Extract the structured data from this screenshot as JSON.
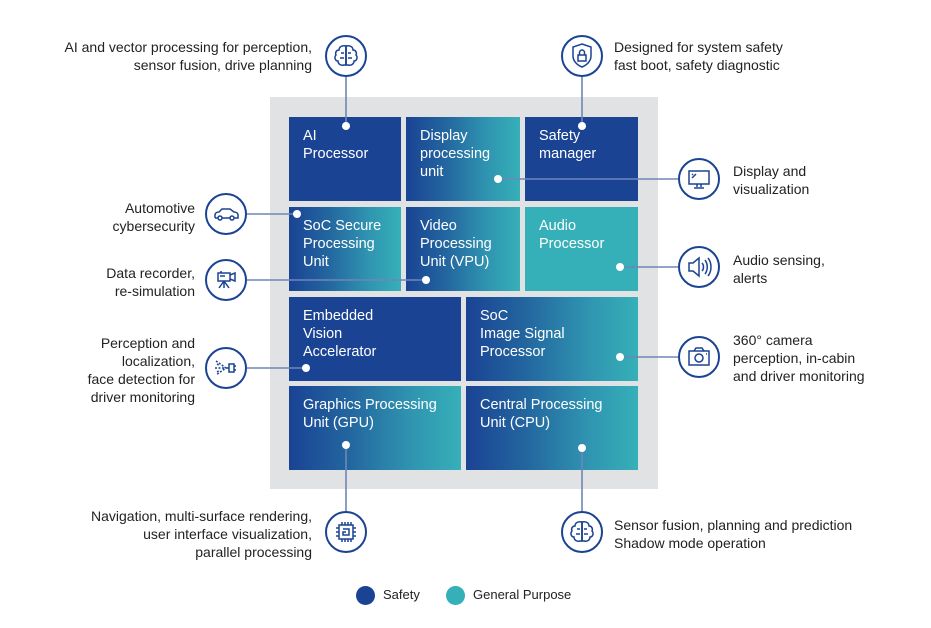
{
  "colors": {
    "safety": "#1a4394",
    "general_purpose": "#36b0b8",
    "frame": "#e1e2e4"
  },
  "blocks": {
    "ai_processor": {
      "label": "AI\nProcessor",
      "type": "safety"
    },
    "display_processing_unit": {
      "label": "Display\nprocessing\nunit",
      "type": "mixed"
    },
    "safety_manager": {
      "label": "Safety\nmanager",
      "type": "safety"
    },
    "soc_secure_processing_unit": {
      "label": "SoC Secure\nProcessing\nUnit",
      "type": "mixed"
    },
    "video_processing_unit": {
      "label": "Video\nProcessing\nUnit (VPU)",
      "type": "mixed"
    },
    "audio_processor": {
      "label": "Audio\nProcessor",
      "type": "general"
    },
    "embedded_vision_accelerator": {
      "label": "Embedded\nVision\nAccelerator",
      "type": "safety"
    },
    "soc_image_signal_processor": {
      "label": "SoC\nImage Signal\nProcessor",
      "type": "mixed"
    },
    "graphics_processing_unit": {
      "label": "Graphics Processing\nUnit (GPU)",
      "type": "mixed"
    },
    "central_processing_unit": {
      "label": "Central Processing\nUnit (CPU)",
      "type": "mixed"
    }
  },
  "callouts": {
    "ai": {
      "icon": "brain-icon",
      "text": "AI and vector processing for perception,\nsensor fusion, drive planning"
    },
    "safety": {
      "icon": "shield-lock-icon",
      "text": "Designed for system safety\nfast boot, safety diagnostic"
    },
    "display": {
      "icon": "monitor-icon",
      "text": "Display and\nvisualization"
    },
    "cybersecurity": {
      "icon": "car-icon",
      "text": "Automotive\ncybersecurity"
    },
    "data_recorder": {
      "icon": "video-camera-icon",
      "text": "Data recorder,\nre-simulation"
    },
    "audio": {
      "icon": "speaker-icon",
      "text": "Audio sensing,\nalerts"
    },
    "perception": {
      "icon": "lidar-sensor-icon",
      "text": "Perception and\nlocalization,\nface detection for\ndriver monitoring"
    },
    "camera": {
      "icon": "camera-icon",
      "text": "360° camera\nperception, in-cabin\nand driver monitoring"
    },
    "gpu": {
      "icon": "chip-icon",
      "text": "Navigation, multi-surface rendering,\nuser interface visualization,\nparallel processing"
    },
    "cpu": {
      "icon": "brain-icon",
      "text": "Sensor fusion, planning and prediction\nShadow mode operation"
    }
  },
  "legend": [
    {
      "label": "Safety",
      "color": "#1a4394"
    },
    {
      "label": "General Purpose",
      "color": "#36b0b8"
    }
  ]
}
